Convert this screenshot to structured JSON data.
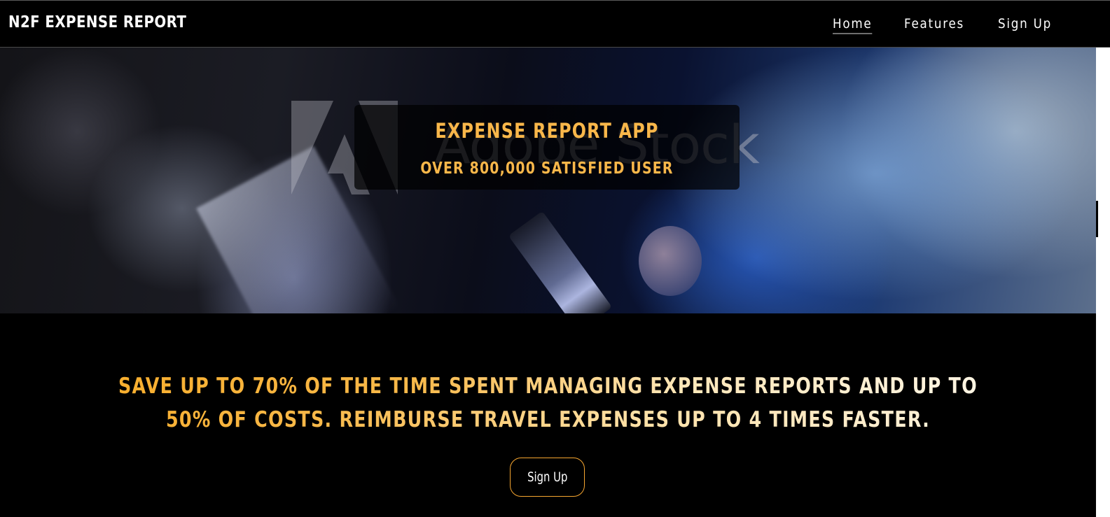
{
  "header": {
    "brand": "N2F EXPENSE REPORT",
    "nav": [
      {
        "label": "Home",
        "active": true
      },
      {
        "label": "Features",
        "active": false
      },
      {
        "label": "Sign Up",
        "active": false
      }
    ]
  },
  "hero": {
    "title": "EXPENSE REPORT APP",
    "subtitle": "OVER 800,000 SATISFIED USER",
    "watermark": "Adobe Stock"
  },
  "main": {
    "tagline_line1": "SAVE UP TO 70% OF THE TIME SPENT MANAGING EXPENSE REPORTS AND UP TO",
    "tagline_line2": "50% OF COSTS. REIMBURSE TRAVEL EXPENSES UP TO 4 TIMES FASTER.",
    "cta_label": "Sign Up"
  },
  "colors": {
    "accent": "#f9b74a",
    "background": "#000000",
    "button_border": "#f6a630",
    "text": "#ffffff"
  }
}
